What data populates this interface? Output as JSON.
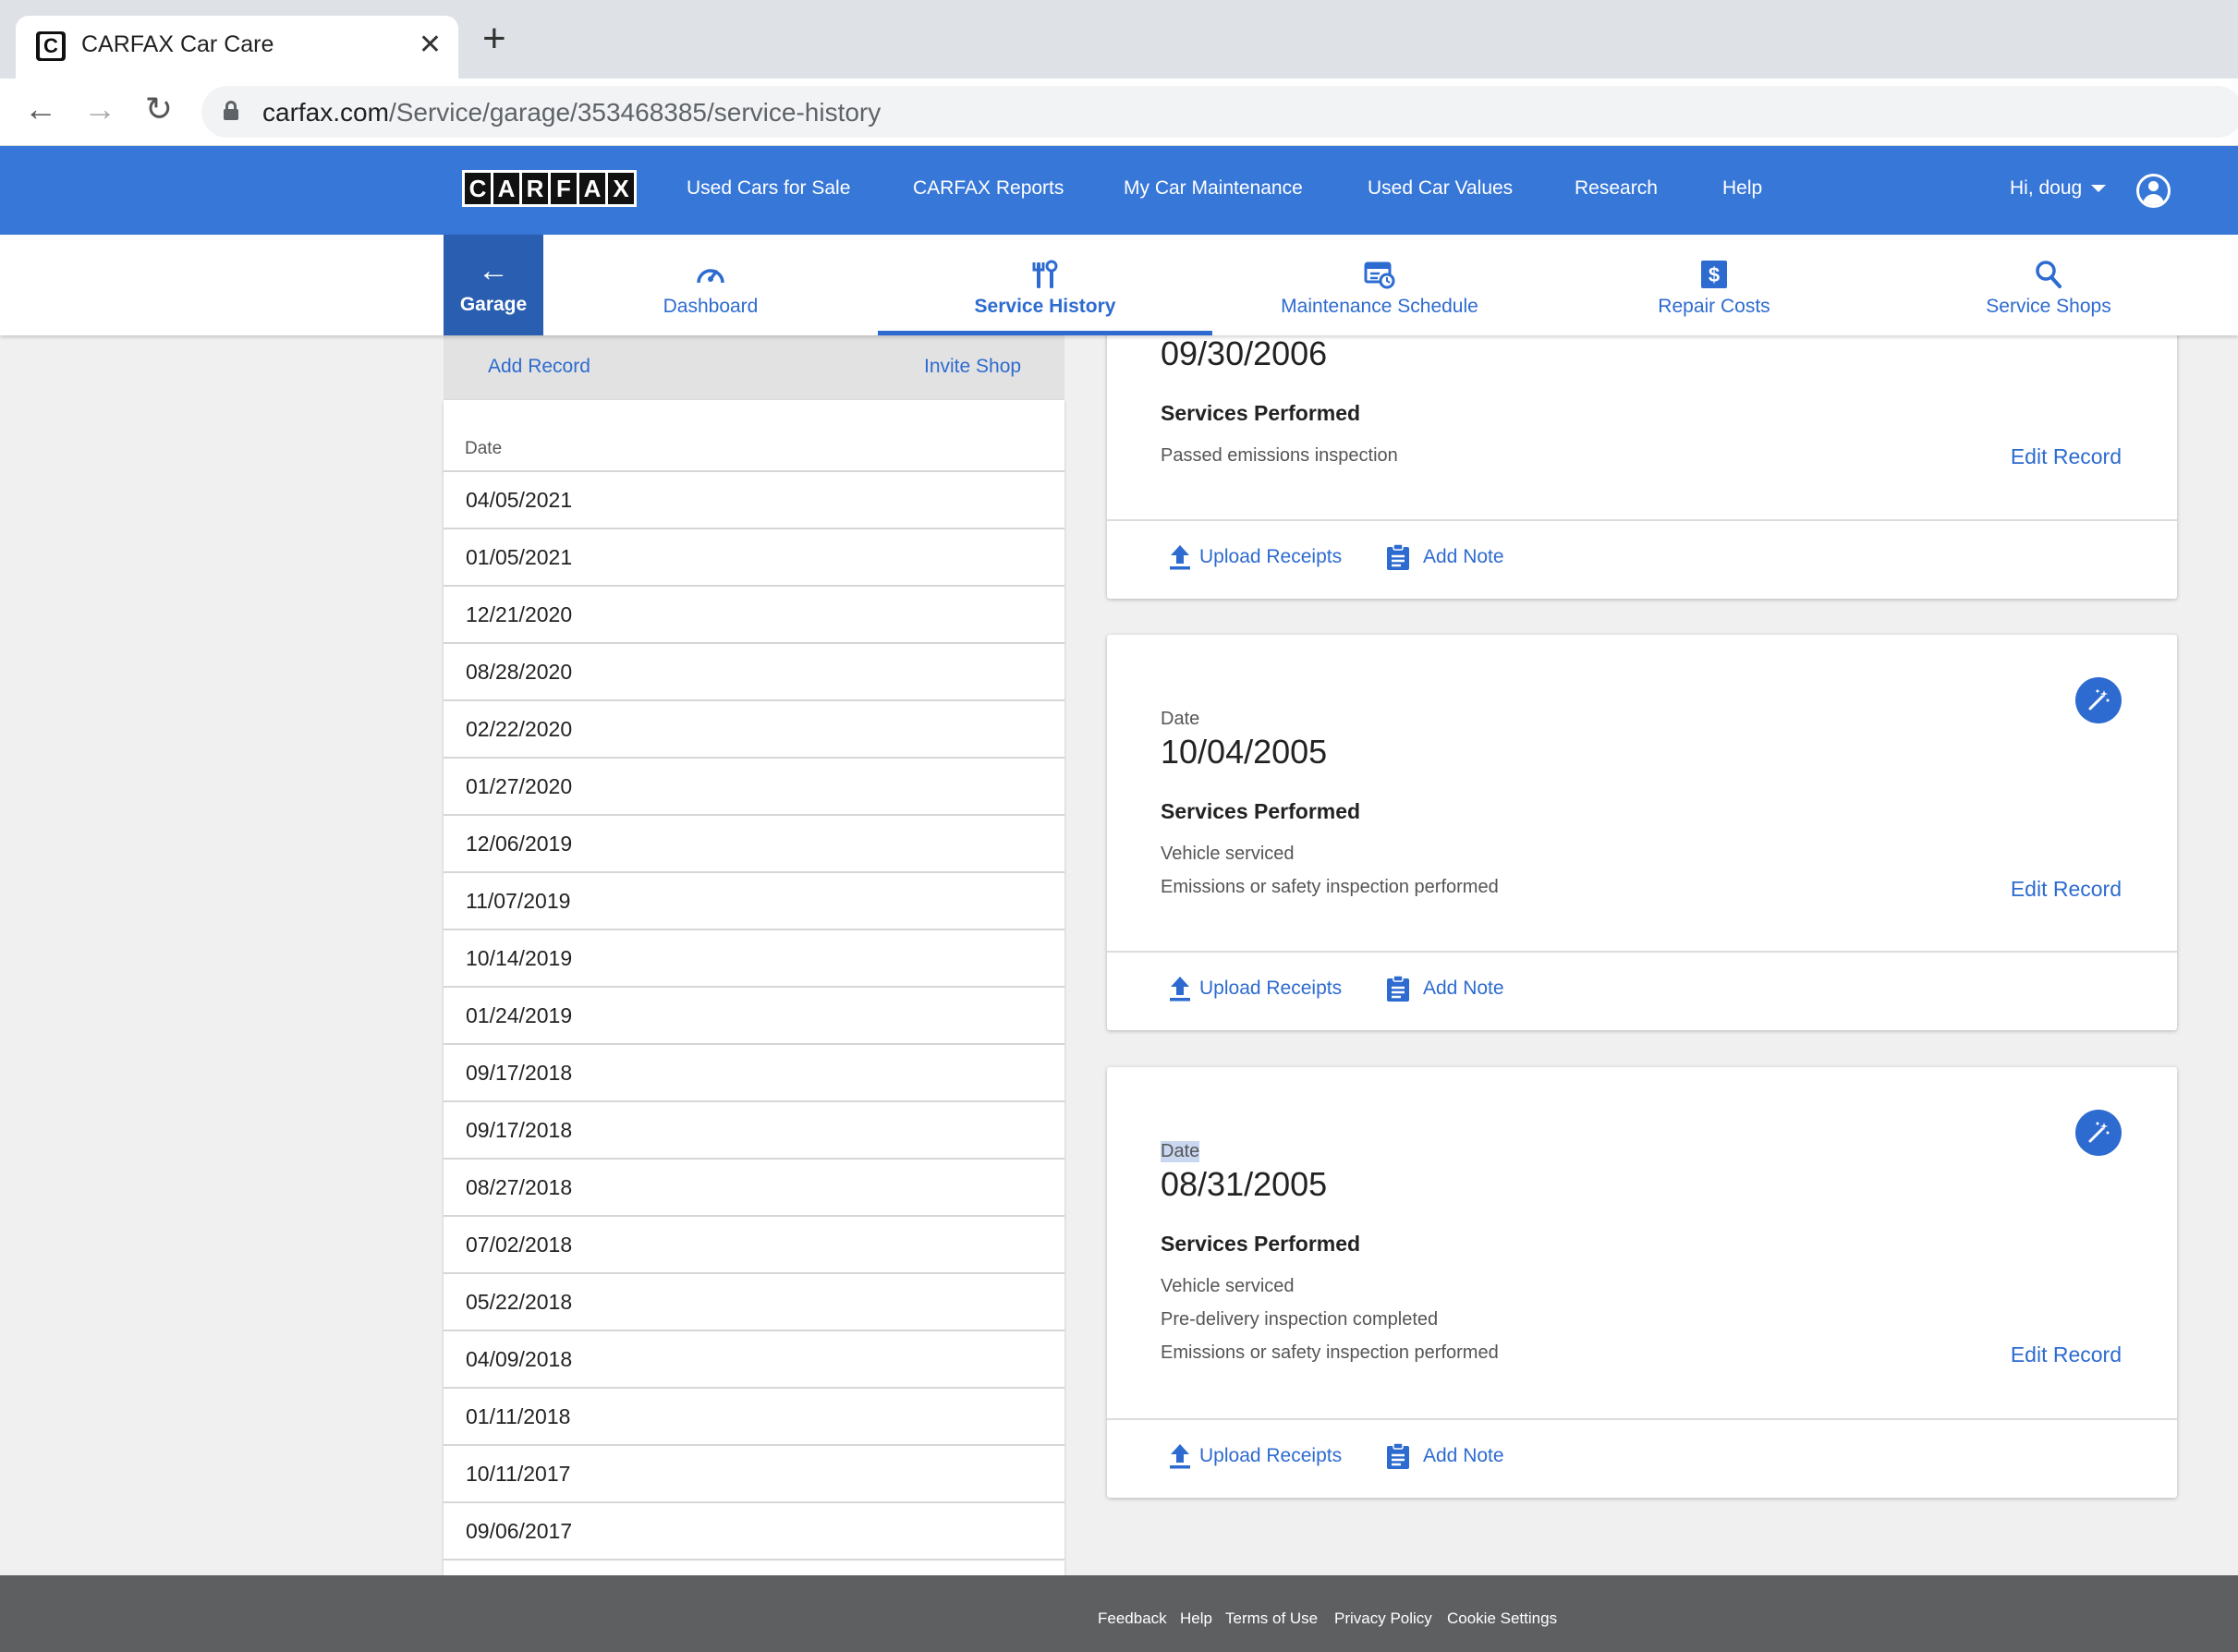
{
  "browser": {
    "tab_title": "CARFAX Car Care",
    "url_domain": "carfax.com",
    "url_path": "/Service/garage/353468385/service-history"
  },
  "header": {
    "logo_letters": [
      "C",
      "A",
      "R",
      "F",
      "A",
      "X"
    ],
    "nav": [
      "Used Cars for Sale",
      "CARFAX Reports",
      "My Car Maintenance",
      "Used Car Values",
      "Research",
      "Help"
    ],
    "user_greeting": "Hi, doug"
  },
  "subnav": {
    "back_label": "Garage",
    "tabs": [
      {
        "label": "Dashboard",
        "icon": "speedometer-icon"
      },
      {
        "label": "Service History",
        "icon": "tools-icon",
        "active": true
      },
      {
        "label": "Maintenance Schedule",
        "icon": "calendar-clock-icon"
      },
      {
        "label": "Repair Costs",
        "icon": "dollar-icon"
      },
      {
        "label": "Service Shops",
        "icon": "search-icon"
      }
    ]
  },
  "sidebar": {
    "add_record": "Add Record",
    "invite_shop": "Invite Shop",
    "column_header": "Date",
    "dates": [
      "04/05/2021",
      "01/05/2021",
      "12/21/2020",
      "08/28/2020",
      "02/22/2020",
      "01/27/2020",
      "12/06/2019",
      "11/07/2019",
      "10/14/2019",
      "01/24/2019",
      "09/17/2018",
      "09/17/2018",
      "08/27/2018",
      "07/02/2018",
      "05/22/2018",
      "04/09/2018",
      "01/11/2018",
      "10/11/2017",
      "09/06/2017"
    ]
  },
  "records": [
    {
      "date": "09/30/2006",
      "services_title": "Services Performed",
      "services": [
        "Passed emissions inspection"
      ],
      "edit_label": "Edit Record",
      "upload_label": "Upload Receipts",
      "note_label": "Add Note"
    },
    {
      "date_label": "Date",
      "date": "10/04/2005",
      "services_title": "Services Performed",
      "services": [
        "Vehicle serviced",
        "Emissions or safety inspection performed"
      ],
      "edit_label": "Edit Record",
      "upload_label": "Upload Receipts",
      "note_label": "Add Note"
    },
    {
      "date_label": "Date",
      "date": "08/31/2005",
      "services_title": "Services Performed",
      "services": [
        "Vehicle serviced",
        "Pre-delivery inspection completed",
        "Emissions or safety inspection performed"
      ],
      "edit_label": "Edit Record",
      "upload_label": "Upload Receipts",
      "note_label": "Add Note"
    }
  ],
  "footer": {
    "links": [
      "Feedback",
      "Help",
      "Terms of Use",
      "Privacy Policy",
      "Cookie Settings"
    ]
  },
  "colors": {
    "brand_blue": "#3777d8",
    "link_blue": "#2d6bd0",
    "footer_gray": "#5e5f61"
  }
}
